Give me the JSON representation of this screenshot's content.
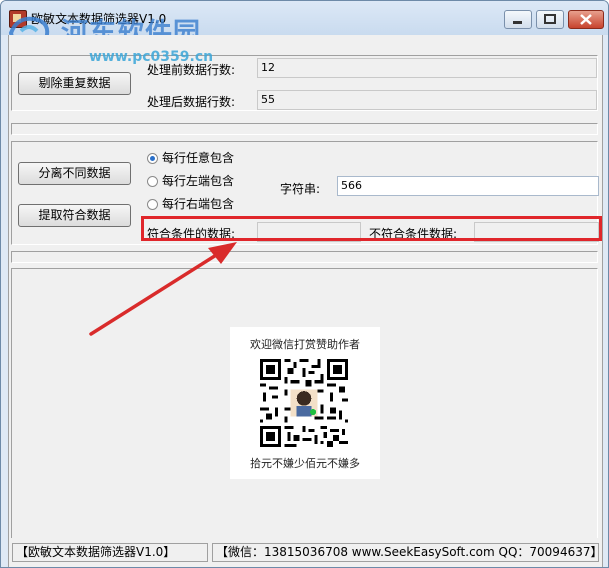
{
  "window": {
    "title": "欧敏文本数据筛选器V1.0",
    "watermark_cn": "河东软件园",
    "watermark_url": "www.pc0359.cn",
    "colors": {
      "accent": "#2a6fc9",
      "highlight": "#e0262b",
      "watermark": "#3b7fcf"
    }
  },
  "dedup": {
    "button": "剔除重复数据",
    "before_label": "处理前数据行数:",
    "before_value": "12",
    "after_label": "处理后数据行数:",
    "after_value": "55"
  },
  "filter": {
    "separate_button": "分离不同数据",
    "extract_button": "提取符合数据",
    "radio_options": [
      {
        "label": "每行任意包含",
        "selected": true
      },
      {
        "label": "每行左端包含",
        "selected": false
      },
      {
        "label": "每行右端包含",
        "selected": false
      }
    ],
    "string_label": "字符串:",
    "string_value": "566",
    "match_label": "符合条件的数据:",
    "match_value": "",
    "nomatch_label": "不符合条件数据:",
    "nomatch_value": ""
  },
  "sponsor": {
    "top_text": "欢迎微信打赏赞助作者",
    "bottom_text": "拾元不嫌少佰元不嫌多"
  },
  "status_bar": {
    "left": "【欧敏文本数据筛选器V1.0】",
    "right": "【微信：13815036708 www.SeekEasySoft.com QQ：70094637】"
  }
}
